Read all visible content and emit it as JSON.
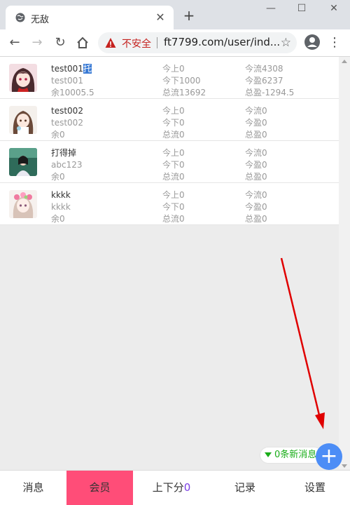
{
  "browser": {
    "tab_title": "无敌",
    "close_glyph": "✕",
    "newtab_glyph": "+",
    "window_buttons": {
      "minimize": "—",
      "maximize": "☐",
      "close": "✕"
    },
    "security_label": "不安全",
    "url": "ft7799.com/user/ind...",
    "colors": {
      "insecure": "#c5221f",
      "tabbar": "#dee1e6"
    }
  },
  "members": [
    {
      "name": "test001",
      "name_highlight": "托",
      "account": "test001",
      "balance": "余10005.5",
      "today_up": "今上0",
      "today_down": "今下1000",
      "total_flow": "总流13692",
      "today_flow": "今流4308",
      "today_profit": "今盈6237",
      "total_profit": "总盈-1294.5",
      "avatar": "anime-girl-avatar"
    },
    {
      "name": "test002",
      "name_highlight": "",
      "account": "test002",
      "balance": "余0",
      "today_up": "今上0",
      "today_down": "今下0",
      "total_flow": "总流0",
      "today_flow": "今流0",
      "today_profit": "今盈0",
      "total_profit": "总盈0",
      "avatar": "anime-girl-avatar-2"
    },
    {
      "name": "打得掉",
      "name_highlight": "",
      "account": "abc123",
      "balance": "余0",
      "today_up": "今上0",
      "today_down": "今下0",
      "total_flow": "总流0",
      "today_flow": "今流0",
      "today_profit": "今盈0",
      "total_profit": "总盈0",
      "avatar": "photo-girl-avatar"
    },
    {
      "name": "kkkk",
      "name_highlight": "",
      "account": "kkkk",
      "balance": "余0",
      "today_up": "今上0",
      "today_down": "今下0",
      "total_flow": "总流0",
      "today_flow": "今流0",
      "today_profit": "今盈0",
      "total_profit": "总盈0",
      "avatar": "flower-girl-avatar"
    }
  ],
  "message_badge": "0条新消息",
  "fab_glyph": "+",
  "bottom_nav": {
    "messages": "消息",
    "members": "会员",
    "updown_label": "上下分",
    "updown_count": "0",
    "records": "记录",
    "settings": "设置",
    "active_color": "#ff4d78"
  },
  "annotation_arrow_color": "#e00000"
}
